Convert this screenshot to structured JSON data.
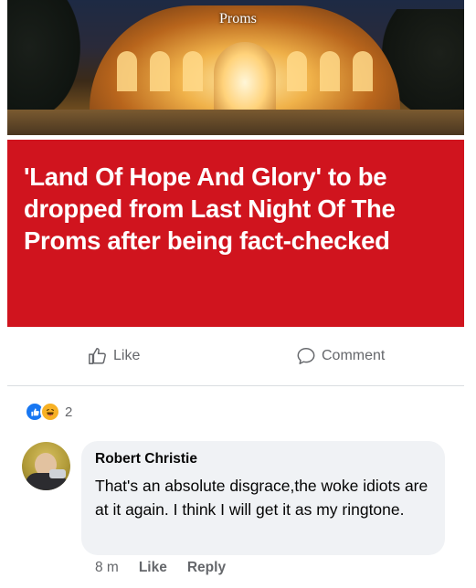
{
  "article": {
    "photo_sign": "Proms",
    "headline": "'Land Of Hope And Glory' to be dropped from Last Night Of The Proms after being fact-checked",
    "headline_bg": "#d0141e"
  },
  "actions": {
    "like_label": "Like",
    "comment_label": "Comment"
  },
  "reactions": {
    "icons": [
      "like-icon",
      "haha-icon"
    ],
    "count": "2"
  },
  "comment": {
    "author": "Robert Christie",
    "text": "That's an absolute disgrace,the woke idiots are at it again. I think I will get it as my ringtone.",
    "time": "8 m",
    "like_label": "Like",
    "reply_label": "Reply"
  },
  "colors": {
    "accent_blue": "#1877f2",
    "muted_text": "#65676b",
    "bubble_bg": "#f0f2f5"
  }
}
